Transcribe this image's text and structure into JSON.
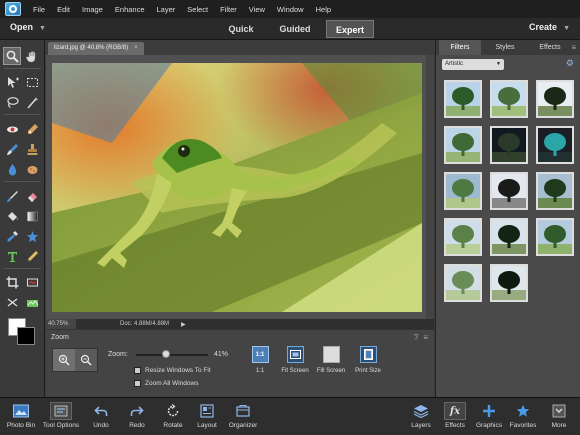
{
  "menubar": {
    "items": [
      "File",
      "Edit",
      "Image",
      "Enhance",
      "Layer",
      "Select",
      "Filter",
      "View",
      "Window",
      "Help"
    ]
  },
  "modebar": {
    "open_label": "Open",
    "tabs": [
      "Quick",
      "Guided",
      "Expert"
    ],
    "active_tab": "Expert",
    "create_label": "Create"
  },
  "document": {
    "tab_title": "lizard.jpg @ 40.8% (RGB/8)",
    "status_zoom": "40.75%",
    "status_doc": "Doc: 4.88M/4.88M"
  },
  "tool_options": {
    "title": "Zoom",
    "zoom_label": "Zoom:",
    "zoom_value": "41%",
    "zoom_fraction": 0.41,
    "resize_windows_label": "Resize Windows To Fit",
    "zoom_all_label": "Zoom All Windows",
    "fit_buttons": [
      {
        "label": "1:1",
        "icon_text": "1:1",
        "icon": "actual-pixels-icon"
      },
      {
        "label": "Fit Screen",
        "icon_text": "",
        "icon": "fit-screen-icon"
      },
      {
        "label": "Fill Screen",
        "icon_text": "",
        "icon": "fill-screen-icon"
      },
      {
        "label": "Print Size",
        "icon_text": "",
        "icon": "print-size-icon"
      }
    ]
  },
  "panel": {
    "tabs": [
      "Filters",
      "Styles",
      "Effects"
    ],
    "active_tab": "Filters",
    "category": "Artistic"
  },
  "taskbar": {
    "left": [
      {
        "label": "Photo Bin",
        "icon": "photo-bin-icon"
      },
      {
        "label": "Tool Options",
        "icon": "tool-options-icon"
      },
      {
        "label": "Undo",
        "icon": "undo-icon"
      },
      {
        "label": "Redo",
        "icon": "redo-icon"
      },
      {
        "label": "Rotate",
        "icon": "rotate-icon"
      },
      {
        "label": "Layout",
        "icon": "layout-icon"
      },
      {
        "label": "Organizer",
        "icon": "organizer-icon"
      }
    ],
    "right": [
      {
        "label": "Layers",
        "icon": "layers-icon"
      },
      {
        "label": "Effects",
        "icon": "fx-icon"
      },
      {
        "label": "Graphics",
        "icon": "plus-icon"
      },
      {
        "label": "Favorites",
        "icon": "star-icon"
      },
      {
        "label": "More",
        "icon": "more-icon"
      }
    ]
  },
  "colors": {
    "accent_blue": "#4c7fb5",
    "menubar_bg": "#1f1f1f",
    "panel_bg": "#4a4a4a"
  }
}
